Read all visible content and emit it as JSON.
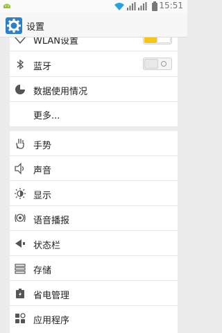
{
  "status_bar": {
    "time": "15:51",
    "icons": [
      "android-icon",
      "wifi-icon",
      "signal-icon",
      "signal-icon",
      "battery-icon"
    ]
  },
  "app_bar": {
    "title": "设置",
    "icon": "settings-gear-icon"
  },
  "section1": {
    "items": [
      {
        "label": "WLAN设置",
        "icon": "wifi-icon",
        "toggle": "on"
      },
      {
        "label": "蓝牙",
        "icon": "bluetooth-icon",
        "toggle": "off"
      },
      {
        "label": "数据使用情况",
        "icon": "data-usage-icon"
      },
      {
        "label": "更多...",
        "icon": ""
      }
    ]
  },
  "section2": {
    "items": [
      {
        "label": "手势",
        "icon": "gesture-hand-icon"
      },
      {
        "label": "声音",
        "icon": "sound-icon"
      },
      {
        "label": "显示",
        "icon": "brightness-icon"
      },
      {
        "label": "语音播报",
        "icon": "voice-broadcast-icon"
      },
      {
        "label": "状态栏",
        "icon": "status-bar-icon"
      },
      {
        "label": "存储",
        "icon": "storage-icon"
      },
      {
        "label": "省电管理",
        "icon": "battery-saver-icon"
      },
      {
        "label": "应用程序",
        "icon": "apps-icon"
      }
    ]
  },
  "colors": {
    "accent": "#2d7fc8",
    "toggle_on": "#f5c518",
    "background": "#ececec"
  }
}
